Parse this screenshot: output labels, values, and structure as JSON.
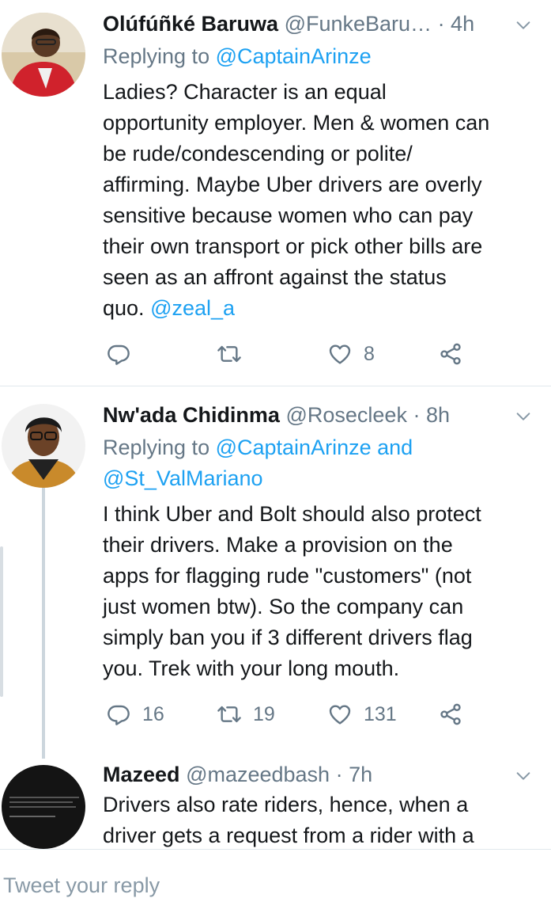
{
  "tweets": [
    {
      "name": "Olúfúñké Baruwa",
      "handle": "@FunkeBaru…",
      "time": "· 4h",
      "replying_prefix": "Replying to ",
      "replying_to": "@CaptainArinze",
      "body_lines": [
        "Ladies? Character is an equal",
        "opportunity employer. Men & women can",
        "be rude/condescending or polite/",
        "affirming. Maybe Uber drivers are overly",
        "sensitive because women who can pay",
        "their own transport or pick other bills are",
        "seen as an affront against the status"
      ],
      "body_last_text": "quo. ",
      "body_last_mention": "@zeal_a",
      "replies": "",
      "retweets": "",
      "likes": "8"
    },
    {
      "name": "Nw'ada Chidinma",
      "handle": "@Rosecleek",
      "time": "· 8h",
      "replying_prefix": "Replying to ",
      "replying_to": "@CaptainArinze and",
      "replying_to_2": "@St_ValMariano",
      "body_lines": [
        "I think Uber and Bolt should also protect",
        "their drivers. Make a provision on the",
        "apps for flagging rude \"customers\" (not",
        "just women btw). So the company can",
        "simply ban you if 3 different drivers flag",
        "you. Trek with your long mouth."
      ],
      "replies": "16",
      "retweets": "19",
      "likes": "131"
    },
    {
      "name": "Mazeed",
      "handle": "@mazeedbash",
      "time": "· 7h",
      "body_lines": [
        "Drivers also rate riders, hence, when a",
        "driver gets a request from a rider with a"
      ]
    }
  ],
  "composer": {
    "placeholder": "Tweet your reply"
  },
  "icons": {
    "reply": "reply-icon",
    "retweet": "retweet-icon",
    "like": "heart-icon",
    "share": "share-icon",
    "menu": "chevron-down-icon"
  },
  "colors": {
    "link": "#1da1f2",
    "muted": "#657786",
    "text": "#14171a",
    "divider": "#e1e8ed"
  }
}
